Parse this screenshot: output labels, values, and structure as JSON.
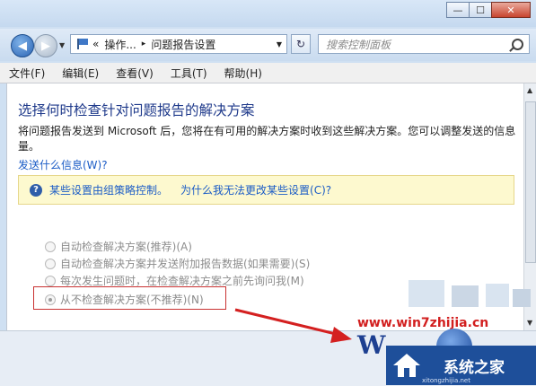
{
  "window": {
    "minimize_icon": "minimize-icon",
    "maximize_icon": "maximize-icon",
    "close_icon": "close-icon",
    "minimize_glyph": "—",
    "maximize_glyph": "☐",
    "close_glyph": "✕"
  },
  "navigation": {
    "back_glyph": "◀",
    "forward_glyph": "▶",
    "dropdown_glyph": "▼",
    "address_prefix": "«",
    "address_part1": "操作...",
    "address_sep": "▸",
    "address_part2": "问题报告设置",
    "refresh_glyph": "↻",
    "search_placeholder": "搜索控制面板"
  },
  "menu": {
    "items": [
      "文件(F)",
      "编辑(E)",
      "查看(V)",
      "工具(T)",
      "帮助(H)"
    ]
  },
  "page": {
    "title": "选择何时检查针对问题报告的解决方案",
    "description": "将问题报告发送到 Microsoft 后，您将在有可用的解决方案时收到这些解决方案。您可以调整发送的信息量。",
    "what_link": "发送什么信息(W)?",
    "info_text": "某些设置由组策略控制。",
    "info_link": "为什么我无法更改某些设置(C)?",
    "options": [
      {
        "label": "自动检查解决方案(推荐)(A)",
        "selected": false
      },
      {
        "label": "自动检查解决方案并发送附加报告数据(如果需要)(S)",
        "selected": false
      },
      {
        "label": "每次发生问题时，在检查解决方案之前先询问我(M)",
        "selected": false
      },
      {
        "label": "从不检查解决方案(不推荐)(N)",
        "selected": true
      }
    ]
  },
  "watermark": {
    "url": "www.win7zhijia.cn",
    "logo_letters": "W",
    "brand": "系统之家",
    "domain": "xitongzhijia.net"
  },
  "colors": {
    "title_blue": "#1f3a8b",
    "link_blue": "#1b5cc6",
    "info_bg": "#fdf9cf",
    "highlight_red": "#c93232"
  }
}
